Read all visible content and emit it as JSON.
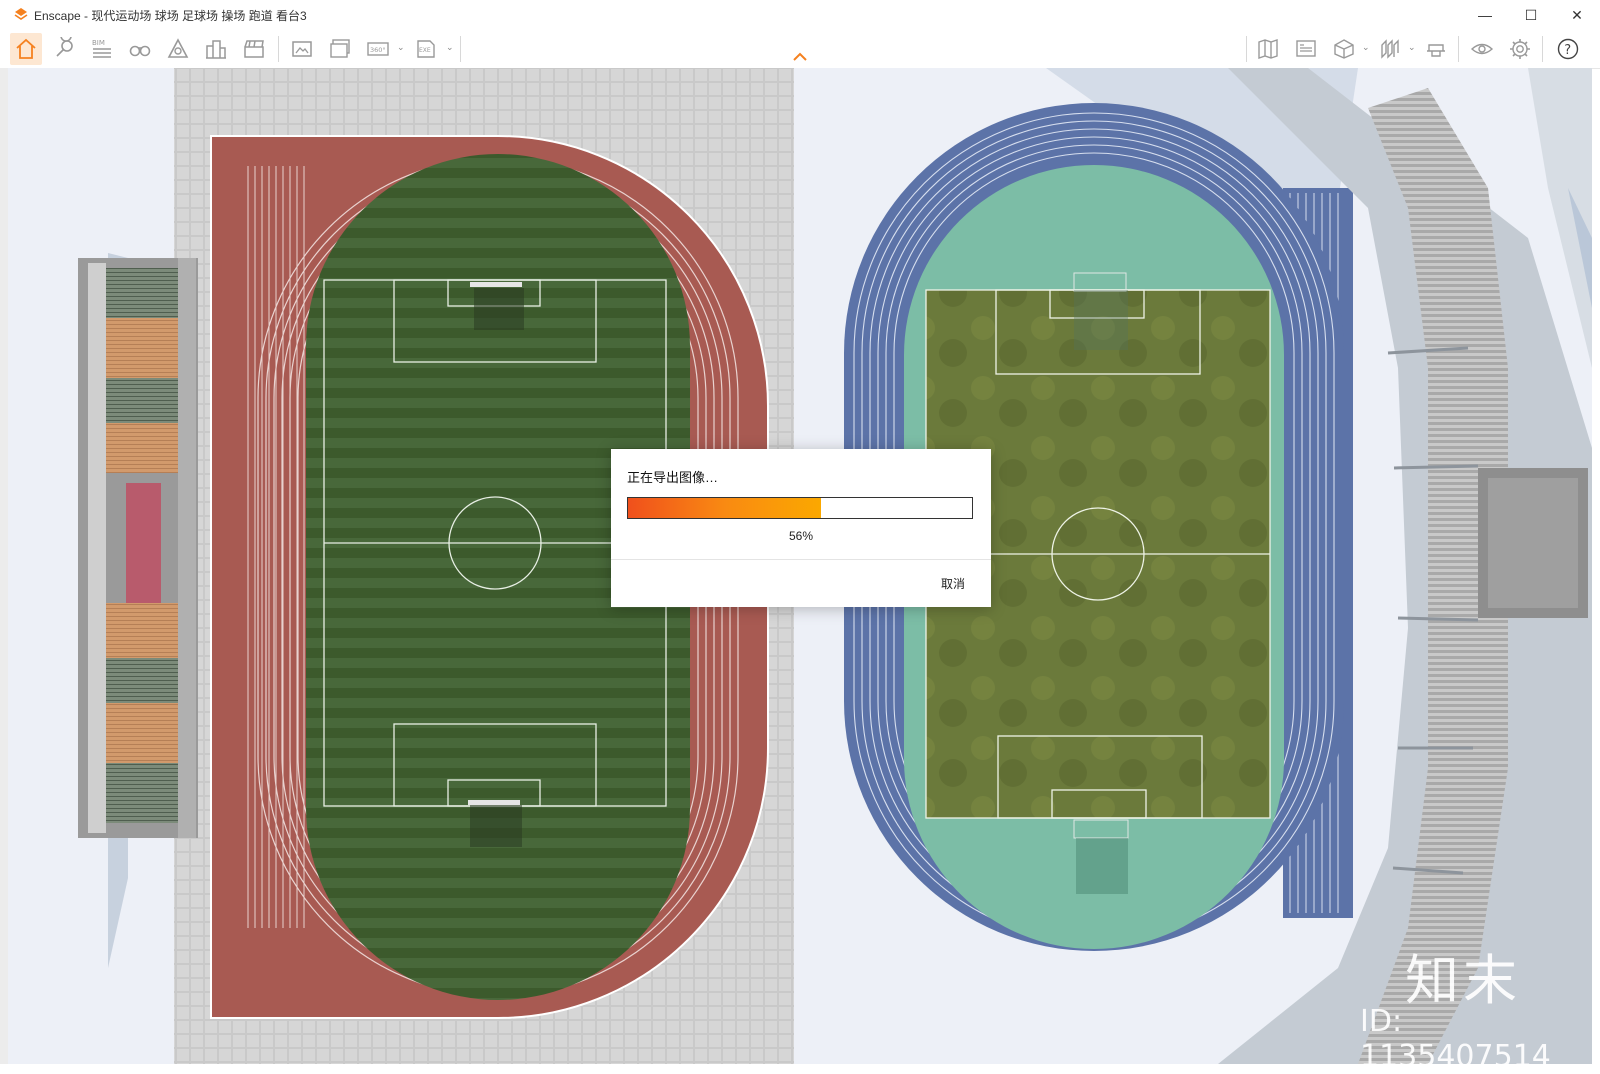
{
  "window": {
    "title": "Enscape - 现代运动场 球场 足球场 操场 跑道 看台3",
    "minimize": "—",
    "maximize": "☐",
    "close": "✕"
  },
  "toolbar": {
    "left_icons": [
      "home-icon",
      "location-pin-icon",
      "bim-icon",
      "binoculars-icon",
      "asset-library-icon",
      "buildings-icon",
      "clapperboard-icon",
      "screenshot-icon",
      "batch-render-icon",
      "panorama-360-icon",
      "export-exe-icon"
    ],
    "bim_label": "BIM",
    "pano_label": "360°",
    "exe_label": "EXE",
    "right_icons": [
      "map-icon",
      "view-management-icon",
      "cube-icon",
      "sections-icon",
      "hat-icon",
      "eye-icon",
      "settings-gear-icon",
      "help-icon"
    ],
    "help_label": "?",
    "dropdown_glyph": "⌄",
    "collapse_glyph": "⌃"
  },
  "colors": {
    "accent": "#f5811f",
    "progress_start": "#f0501c",
    "progress_end": "#fba800",
    "track_red": "#a85a52",
    "track_blue": "#5c73a8",
    "infield_teal": "#7cbda6",
    "grass_dark": "#3c5a2c",
    "grass_olive": "#6b7a3b"
  },
  "dialog": {
    "title": "正在导出图像…",
    "progress_value": 0.56,
    "progress_text": "56%",
    "cancel_label": "取消"
  },
  "watermark": {
    "logo": "知末",
    "id_text": "ID: 1135407514"
  }
}
